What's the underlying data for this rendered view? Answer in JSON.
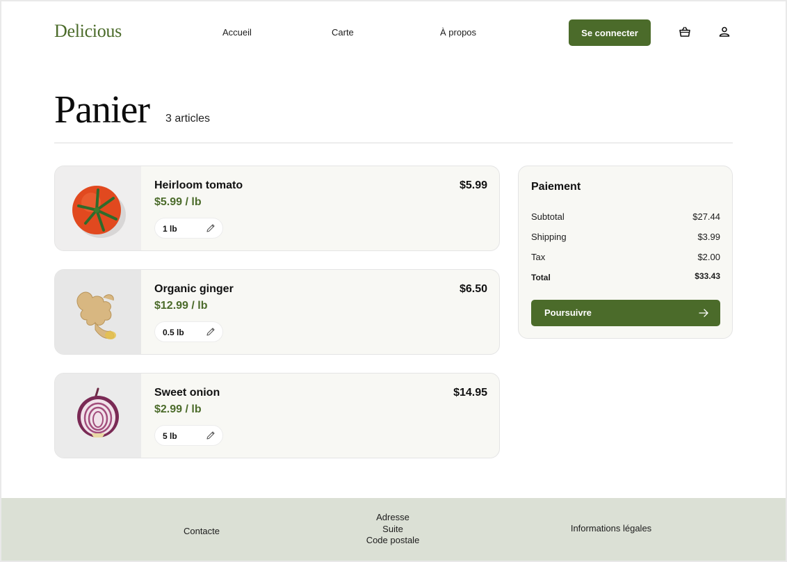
{
  "brand": {
    "logo": "Delicious",
    "accent": "#4b6b2a"
  },
  "nav": {
    "links": [
      {
        "label": "Accueil"
      },
      {
        "label": "Carte"
      },
      {
        "label": "À propos"
      }
    ],
    "login_label": "Se connecter",
    "icons": [
      "basket-icon",
      "user-icon"
    ]
  },
  "cart": {
    "title": "Panier",
    "count_label": "3 articles",
    "items": [
      {
        "name": "Heirloom tomato",
        "unit_price": "$5.99 / lb",
        "total": "$5.99",
        "quantity": "1 lb",
        "image": "tomato"
      },
      {
        "name": "Organic ginger",
        "unit_price": "$12.99 / lb",
        "total": "$6.50",
        "quantity": "0.5 lb",
        "image": "ginger"
      },
      {
        "name": "Sweet onion",
        "unit_price": "$2.99 / lb",
        "total": "$14.95",
        "quantity": "5 lb",
        "image": "onion"
      }
    ]
  },
  "payment": {
    "title": "Paiement",
    "rows": [
      {
        "label": "Subtotal",
        "value": "$27.44"
      },
      {
        "label": "Shipping",
        "value": "$3.99"
      },
      {
        "label": "Tax",
        "value": "$2.00"
      },
      {
        "label": "Total",
        "value": "$33.43"
      }
    ],
    "continue_label": "Poursuivre"
  },
  "footer": {
    "contact": "Contacte",
    "address_lines": [
      "Adresse",
      "Suite",
      "Code postale"
    ],
    "legal": "Informations légales"
  }
}
